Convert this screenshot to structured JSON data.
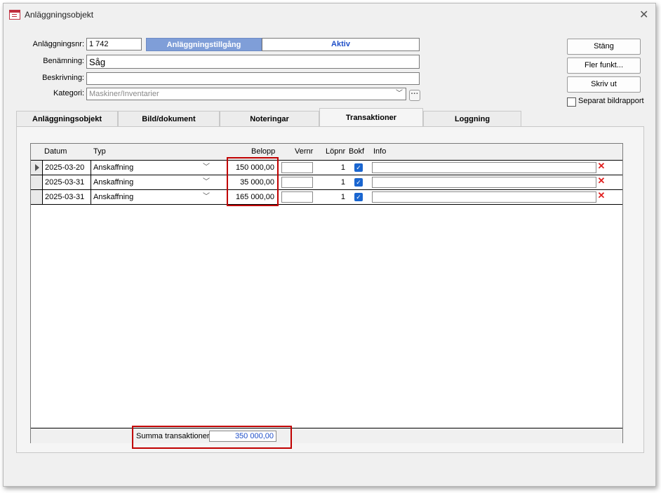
{
  "window": {
    "title": "Anläggningsobjekt"
  },
  "form": {
    "nr_label": "Anläggningsnr:",
    "nr_value": "1 742",
    "status_type": "Anläggningstillgång",
    "status_state": "Aktiv",
    "benamning_label": "Benämning:",
    "benamning_value": "Såg",
    "beskrivning_label": "Beskrivning:",
    "beskrivning_value": "",
    "kategori_label": "Kategori:",
    "kategori_value": "Maskiner/Inventarier"
  },
  "buttons": {
    "close": "Stäng",
    "more": "Fler funkt...",
    "print": "Skriv ut",
    "separate_report": "Separat bildrapport"
  },
  "tabs": [
    {
      "label": "Anläggningsobjekt"
    },
    {
      "label": "Bild/dokument"
    },
    {
      "label": "Noteringar"
    },
    {
      "label": "Transaktioner"
    },
    {
      "label": "Loggning"
    }
  ],
  "grid": {
    "headers": {
      "datum": "Datum",
      "typ": "Typ",
      "belopp": "Belopp",
      "vernr": "Vernr",
      "lopnr": "Löpnr",
      "bokf": "Bokf",
      "info": "Info"
    },
    "rows": [
      {
        "datum": "2025-03-20",
        "typ": "Anskaffning",
        "belopp": "150 000,00",
        "vernr": "",
        "lopnr": "1",
        "info": ""
      },
      {
        "datum": "2025-03-31",
        "typ": "Anskaffning",
        "belopp": "35 000,00",
        "vernr": "",
        "lopnr": "1",
        "info": ""
      },
      {
        "datum": "2025-03-31",
        "typ": "Anskaffning",
        "belopp": "165 000,00",
        "vernr": "",
        "lopnr": "1",
        "info": ""
      }
    ],
    "sum_label": "Summa transaktioner:",
    "sum_value": "350 000,00"
  },
  "colors": {
    "status_bg": "#7f9ed8",
    "status_text": "#1f4fc8",
    "highlight": "#c00000",
    "checkbox": "#1a66d0"
  }
}
